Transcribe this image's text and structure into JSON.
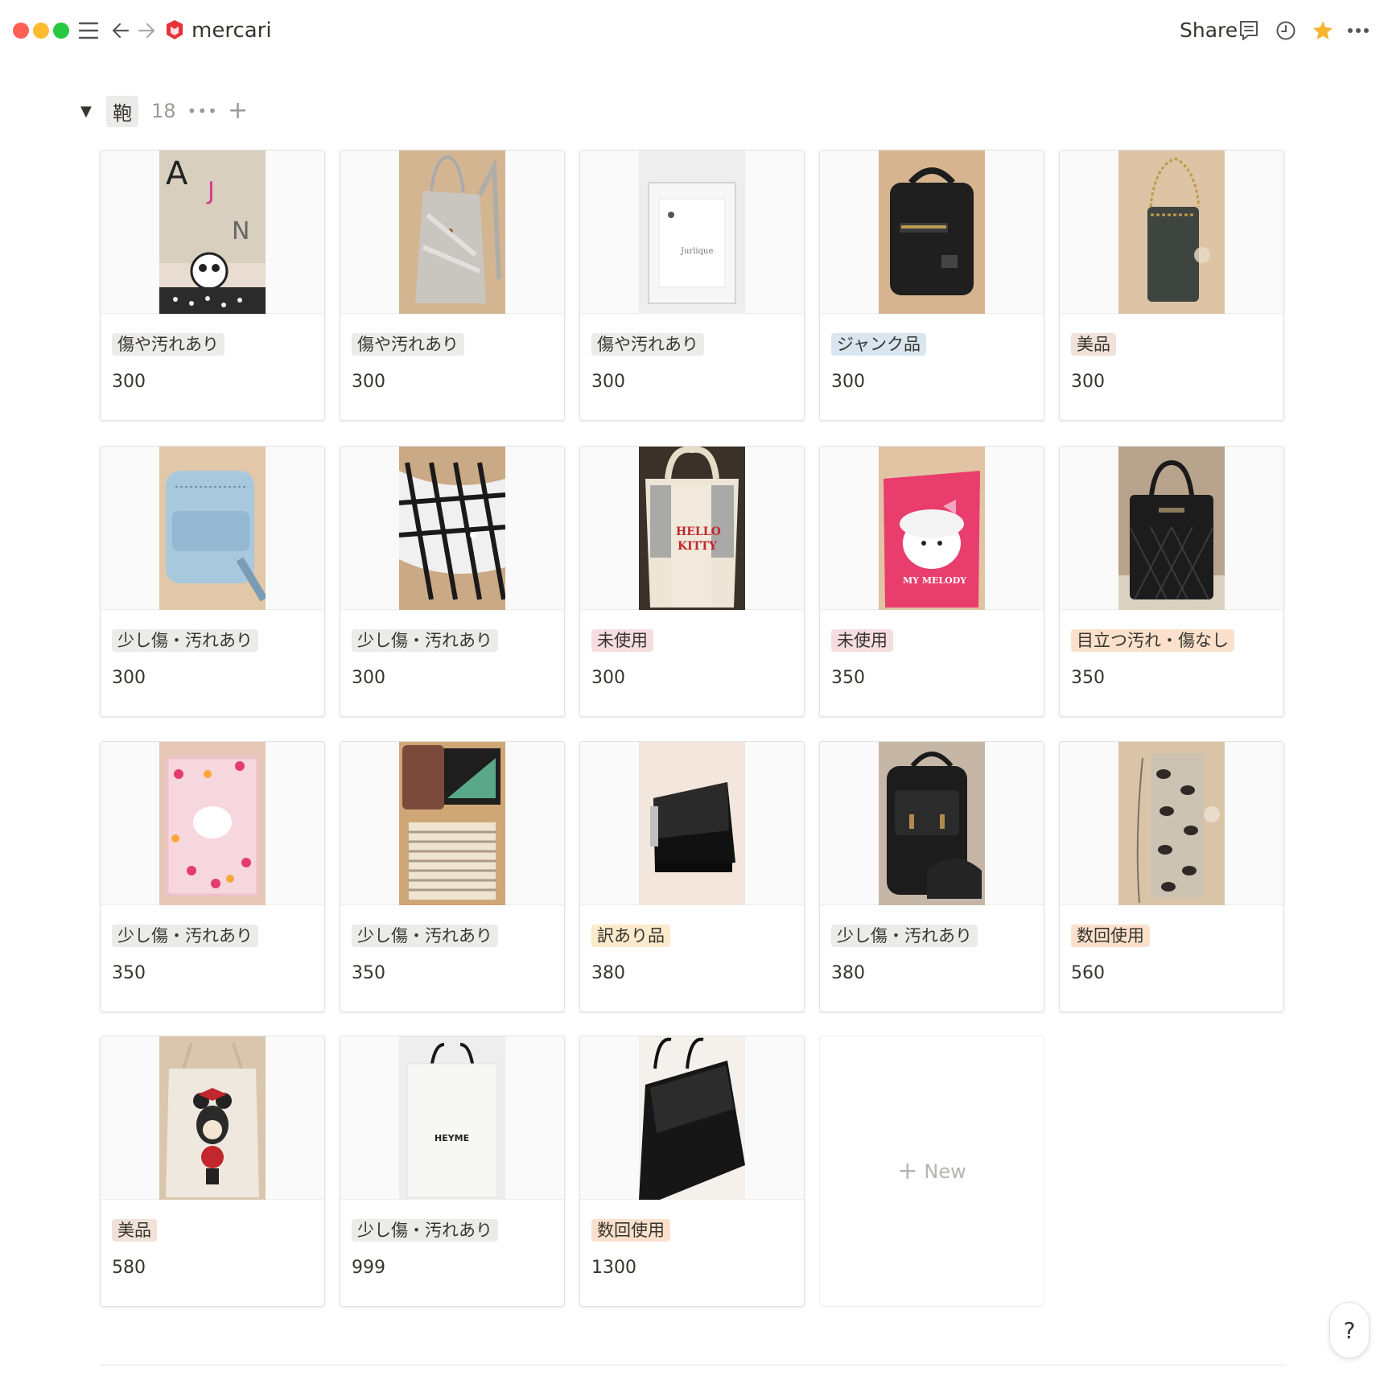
{
  "window": {
    "title": "mercari",
    "share_label": "Share"
  },
  "icons": {
    "menu": "menu-icon",
    "back": "arrow-left-icon",
    "forward": "arrow-right-icon",
    "comment": "comment-icon",
    "history": "clock-icon",
    "favorite": "star-icon",
    "more": "more-icon",
    "help": "help-icon"
  },
  "colors": {
    "star": "#f5b431",
    "tag_gray_bg": "#ebebea",
    "tag_blue_bg": "#d9e6ef",
    "tag_orange_bg": "#fbe1cc",
    "tag_pink_bg": "#f6dddf",
    "tag_brown_bg": "#f0e1d9",
    "tag_yellow_bg": "#fbeacb"
  },
  "group": {
    "toggle": "▼",
    "name": "鞄",
    "count": "18",
    "more": "•••",
    "add": "+"
  },
  "cards": [
    {
      "tag": "傷や汚れあり",
      "price": "300",
      "tag_color": "gray",
      "img": "panda"
    },
    {
      "tag": "傷や汚れあり",
      "price": "300",
      "tag_color": "gray",
      "img": "silver"
    },
    {
      "tag": "傷や汚れあり",
      "price": "300",
      "tag_color": "gray",
      "img": "clear"
    },
    {
      "tag": "ジャンク品",
      "price": "300",
      "tag_color": "blue",
      "img": "blackbag"
    },
    {
      "tag": "美品",
      "price": "300",
      "tag_color": "brown",
      "img": "chainpouch"
    },
    {
      "tag": "少し傷・汚れあり",
      "price": "300",
      "tag_color": "gray",
      "img": "denim"
    },
    {
      "tag": "少し傷・汚れあり",
      "price": "300",
      "tag_color": "gray",
      "img": "plaid"
    },
    {
      "tag": "未使用",
      "price": "300",
      "tag_color": "pink",
      "img": "kitty"
    },
    {
      "tag": "未使用",
      "price": "350",
      "tag_color": "pink",
      "img": "melody"
    },
    {
      "tag": "目立つ汚れ・傷なし",
      "price": "350",
      "tag_color": "orange",
      "img": "quilted"
    },
    {
      "tag": "少し傷・汚れあり",
      "price": "350",
      "tag_color": "gray",
      "img": "pinkclear"
    },
    {
      "tag": "少し傷・汚れあり",
      "price": "350",
      "tag_color": "gray",
      "img": "stripes"
    },
    {
      "tag": "訳あり品",
      "price": "380",
      "tag_color": "yellow",
      "img": "messenger"
    },
    {
      "tag": "少し傷・汚れあり",
      "price": "380",
      "tag_color": "gray",
      "img": "backpack"
    },
    {
      "tag": "数回使用",
      "price": "560",
      "tag_color": "orange",
      "img": "snake"
    },
    {
      "tag": "美品",
      "price": "580",
      "tag_color": "brown",
      "img": "minnie"
    },
    {
      "tag": "少し傷・汚れあり",
      "price": "999",
      "tag_color": "gray",
      "img": "heyme"
    },
    {
      "tag": "数回使用",
      "price": "1300",
      "tag_color": "orange",
      "img": "tote"
    }
  ],
  "heyme_text": "HEYME",
  "new_card": {
    "icon": "+",
    "label": "New"
  },
  "help_label": "?"
}
